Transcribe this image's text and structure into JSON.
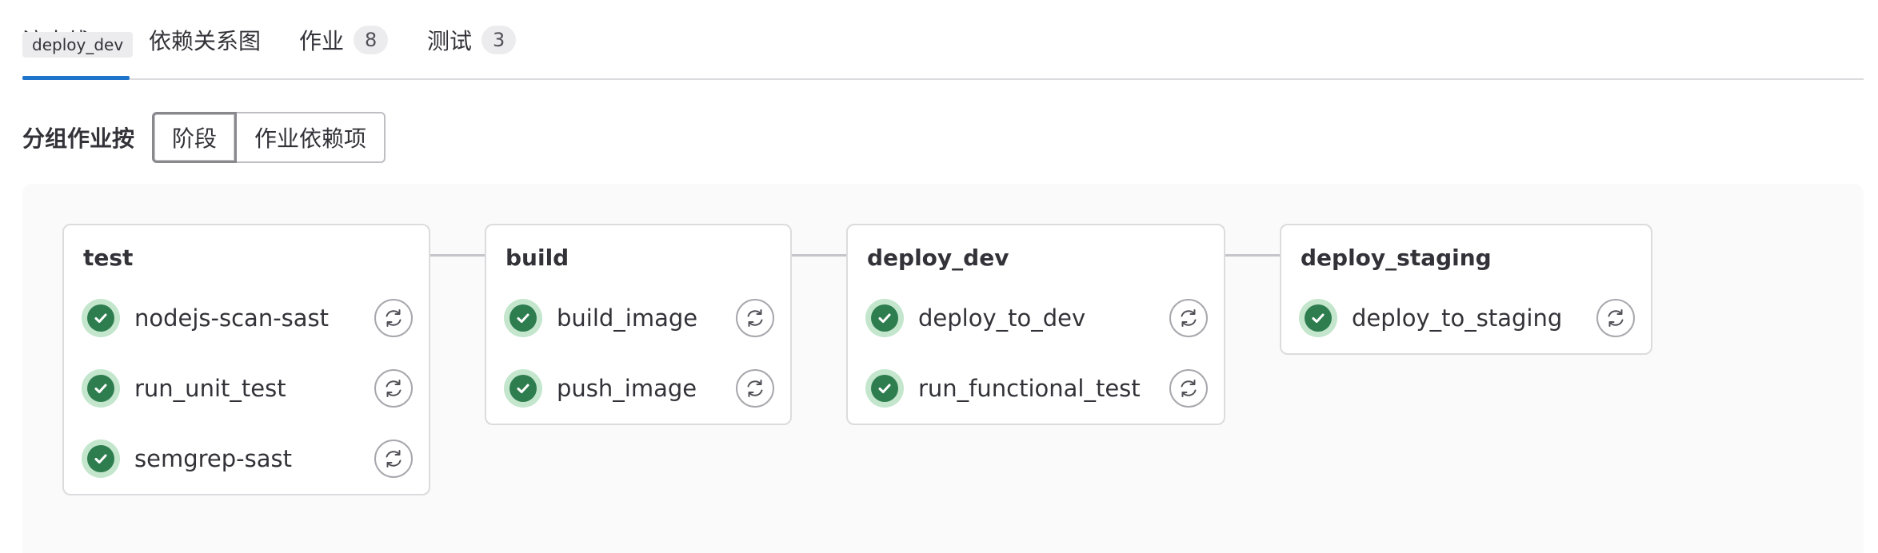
{
  "tooltip": "deploy_dev",
  "tabs": [
    {
      "label": "流水线"
    },
    {
      "label": "依赖关系图"
    },
    {
      "label": "作业",
      "count": "8"
    },
    {
      "label": "测试",
      "count": "3"
    }
  ],
  "group_by": {
    "label": "分组作业按",
    "options": [
      "阶段",
      "作业依赖项"
    ],
    "selected": "阶段"
  },
  "stages": [
    {
      "name": "test",
      "jobs": [
        "nodejs-scan-sast",
        "run_unit_test",
        "semgrep-sast"
      ]
    },
    {
      "name": "build",
      "jobs": [
        "build_image",
        "push_image"
      ]
    },
    {
      "name": "deploy_dev",
      "jobs": [
        "deploy_to_dev",
        "run_functional_test"
      ]
    },
    {
      "name": "deploy_staging",
      "jobs": [
        "deploy_to_staging"
      ]
    }
  ],
  "icons": {
    "job_status": "success-check-icon",
    "job_action": "retry-icon"
  },
  "colors": {
    "accent": "#1f75cb",
    "success": "#2e7d4f",
    "success_bg": "#c3e6cd"
  }
}
